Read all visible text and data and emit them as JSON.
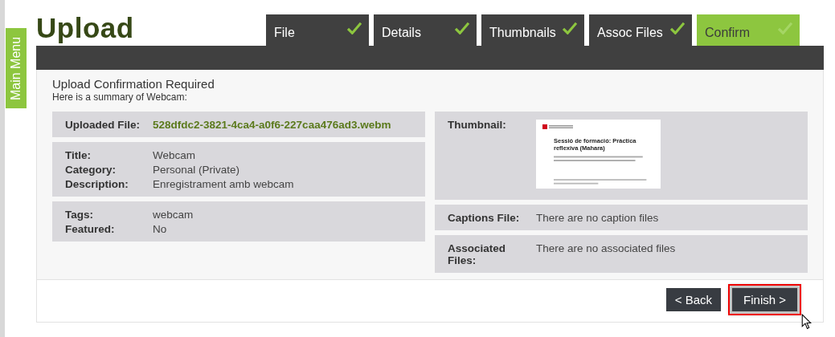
{
  "sidebar_tab": {
    "label": "Main Menu"
  },
  "title": "Upload",
  "steps": [
    {
      "label": "File",
      "completed": true,
      "selected": false
    },
    {
      "label": "Details",
      "completed": true,
      "selected": false
    },
    {
      "label": "Thumbnails",
      "completed": true,
      "selected": false
    },
    {
      "label": "Assoc Files",
      "completed": true,
      "selected": false
    },
    {
      "label": "Confirm",
      "completed": true,
      "selected": true
    }
  ],
  "heading": "Upload Confirmation Required",
  "subheading": "Here is a summary of Webcam:",
  "left_cards": [
    {
      "fields": [
        {
          "label": "Uploaded File:",
          "value": "528dfdc2-3821-4ca4-a0f6-227caa476ad3.webm",
          "kind": "link"
        }
      ]
    },
    {
      "fields": [
        {
          "label": "Title:",
          "value": "Webcam",
          "kind": "text"
        },
        {
          "label": "Category:",
          "value": "Personal (Private)",
          "kind": "text"
        },
        {
          "label": "Description:",
          "value": "Enregistrament amb webcam",
          "kind": "text"
        }
      ]
    },
    {
      "fields": [
        {
          "label": "Tags:",
          "value": "webcam",
          "kind": "text"
        },
        {
          "label": "Featured:",
          "value": "No",
          "kind": "text"
        }
      ]
    }
  ],
  "right_cards": [
    {
      "fields": [
        {
          "label": "Thumbnail:",
          "kind": "thumbnail",
          "slide_title": "Sessió de formació: Pràctica reflexiva (Mahara)"
        }
      ]
    },
    {
      "fields": [
        {
          "label": "Captions File:",
          "value": "There are no caption files",
          "kind": "text"
        }
      ]
    },
    {
      "fields": [
        {
          "label": "Associated Files:",
          "value": "There are no associated files",
          "kind": "text"
        }
      ]
    }
  ],
  "buttons": [
    {
      "label": "< Back",
      "focused": false
    },
    {
      "label": "Finish >",
      "focused": true
    }
  ]
}
